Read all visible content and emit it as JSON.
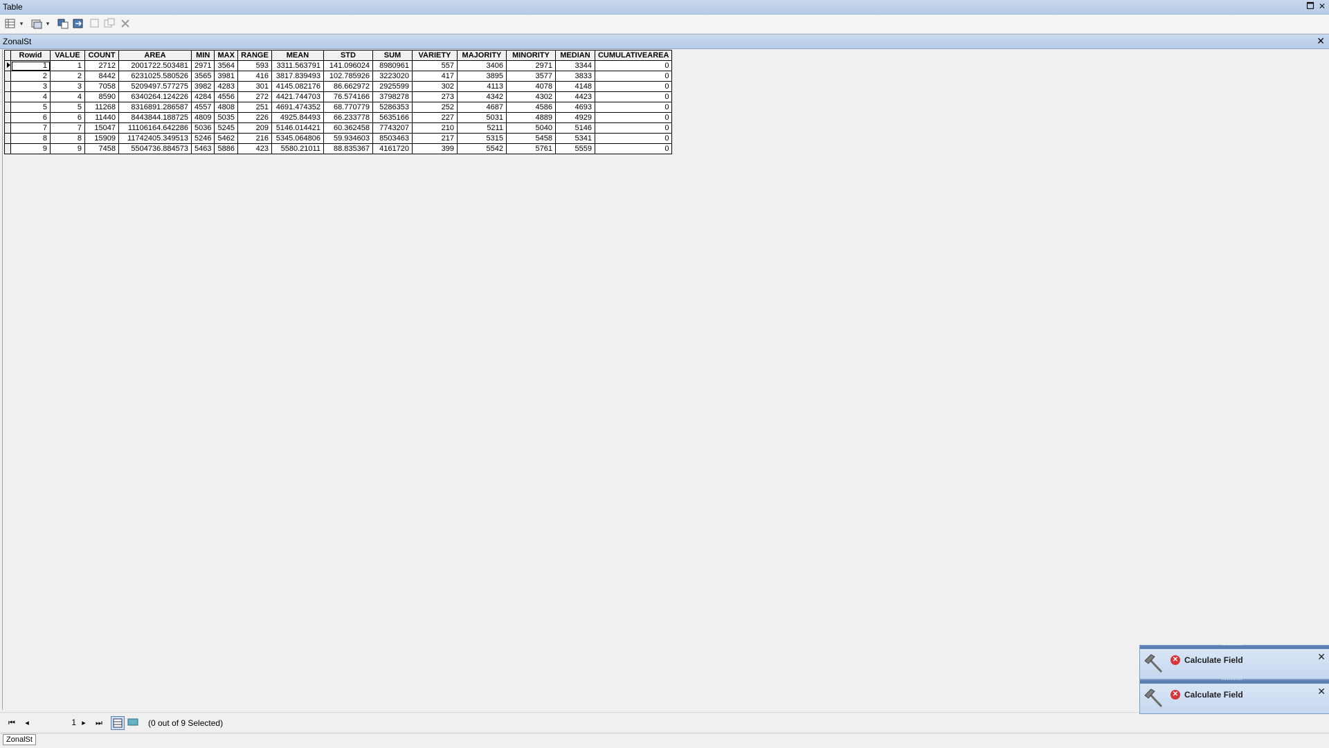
{
  "window": {
    "title": "Table"
  },
  "table_tab": {
    "title": "ZonalSt"
  },
  "columns": [
    "Rowid",
    "VALUE",
    "COUNT",
    "AREA",
    "MIN",
    "MAX",
    "RANGE",
    "MEAN",
    "STD",
    "SUM",
    "VARIETY",
    "MAJORITY",
    "MINORITY",
    "MEDIAN",
    "CUMULATIVEAREA"
  ],
  "rows": [
    [
      "1",
      "1",
      "2712",
      "2001722.503481",
      "2971",
      "3564",
      "593",
      "3311.563791",
      "141.096024",
      "8980961",
      "557",
      "3406",
      "2971",
      "3344",
      "0"
    ],
    [
      "2",
      "2",
      "8442",
      "6231025.580526",
      "3565",
      "3981",
      "416",
      "3817.839493",
      "102.785926",
      "3223020",
      "417",
      "3895",
      "3577",
      "3833",
      "0"
    ],
    [
      "3",
      "3",
      "7058",
      "5209497.577275",
      "3982",
      "4283",
      "301",
      "4145.082176",
      "86.662972",
      "2925599",
      "302",
      "4113",
      "4078",
      "4148",
      "0"
    ],
    [
      "4",
      "4",
      "8590",
      "6340264.124226",
      "4284",
      "4556",
      "272",
      "4421.744703",
      "76.574166",
      "3798278",
      "273",
      "4342",
      "4302",
      "4423",
      "0"
    ],
    [
      "5",
      "5",
      "11268",
      "8316891.286587",
      "4557",
      "4808",
      "251",
      "4691.474352",
      "68.770779",
      "5286353",
      "252",
      "4687",
      "4586",
      "4693",
      "0"
    ],
    [
      "6",
      "6",
      "11440",
      "8443844.188725",
      "4809",
      "5035",
      "226",
      "4925.84493",
      "66.233778",
      "5635166",
      "227",
      "5031",
      "4889",
      "4929",
      "0"
    ],
    [
      "7",
      "7",
      "15047",
      "11106164.642286",
      "5036",
      "5245",
      "209",
      "5146.014421",
      "60.362458",
      "7743207",
      "210",
      "5211",
      "5040",
      "5146",
      "0"
    ],
    [
      "8",
      "8",
      "15909",
      "11742405.349513",
      "5246",
      "5462",
      "216",
      "5345.064806",
      "59.934603",
      "8503463",
      "217",
      "5315",
      "5458",
      "5341",
      "0"
    ],
    [
      "9",
      "9",
      "7458",
      "5504736.884573",
      "5463",
      "5886",
      "423",
      "5580.21011",
      "88.835367",
      "4161720",
      "399",
      "5542",
      "5761",
      "5559",
      "0"
    ]
  ],
  "status": {
    "current_record": "1",
    "selection_text": "(0 out of 9 Selected)"
  },
  "bottom_tab": {
    "label": "ZonalSt"
  },
  "notifications": [
    {
      "label": "Calculate Field",
      "status_icon": "error-icon"
    },
    {
      "label": "Calculate Field",
      "status_icon": "error-icon"
    }
  ]
}
